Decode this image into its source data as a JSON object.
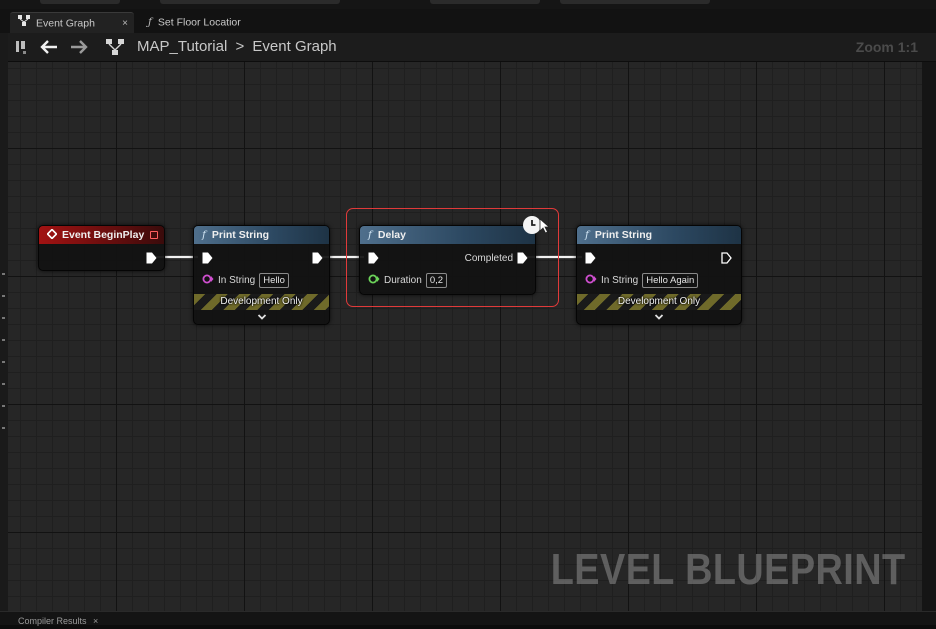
{
  "tabs": [
    {
      "label": "Event Graph",
      "icon": "graph-icon",
      "close": "×"
    },
    {
      "label": "Set Floor Locatior",
      "icon": "function-icon"
    }
  ],
  "toolbar": {
    "breadcrumb": [
      "MAP_Tutorial",
      ">",
      "Event Graph"
    ],
    "zoom": "Zoom 1:1"
  },
  "nodes": {
    "event_begin_play": {
      "title": "Event BeginPlay",
      "color": "#a21212"
    },
    "print_string_1": {
      "title": "Print String",
      "fx": "f",
      "pin_label": "In String",
      "value": "Hello",
      "footer": "Development Only"
    },
    "delay": {
      "title": "Delay",
      "fx": "f",
      "output_label": "Completed",
      "pin_label": "Duration",
      "value": "0,2"
    },
    "print_string_2": {
      "title": "Print String",
      "fx": "f",
      "pin_label": "In String",
      "value": "Hello Again",
      "footer": "Development Only"
    }
  },
  "colors": {
    "func_header": "#2c4861",
    "selection": "#e03a3a",
    "string_pin": "#d04fd0",
    "float_pin": "#6cd45a"
  },
  "watermark": "LEVEL BLUEPRINT",
  "bottom_tab": {
    "label": "Compiler Results",
    "close": "×"
  }
}
